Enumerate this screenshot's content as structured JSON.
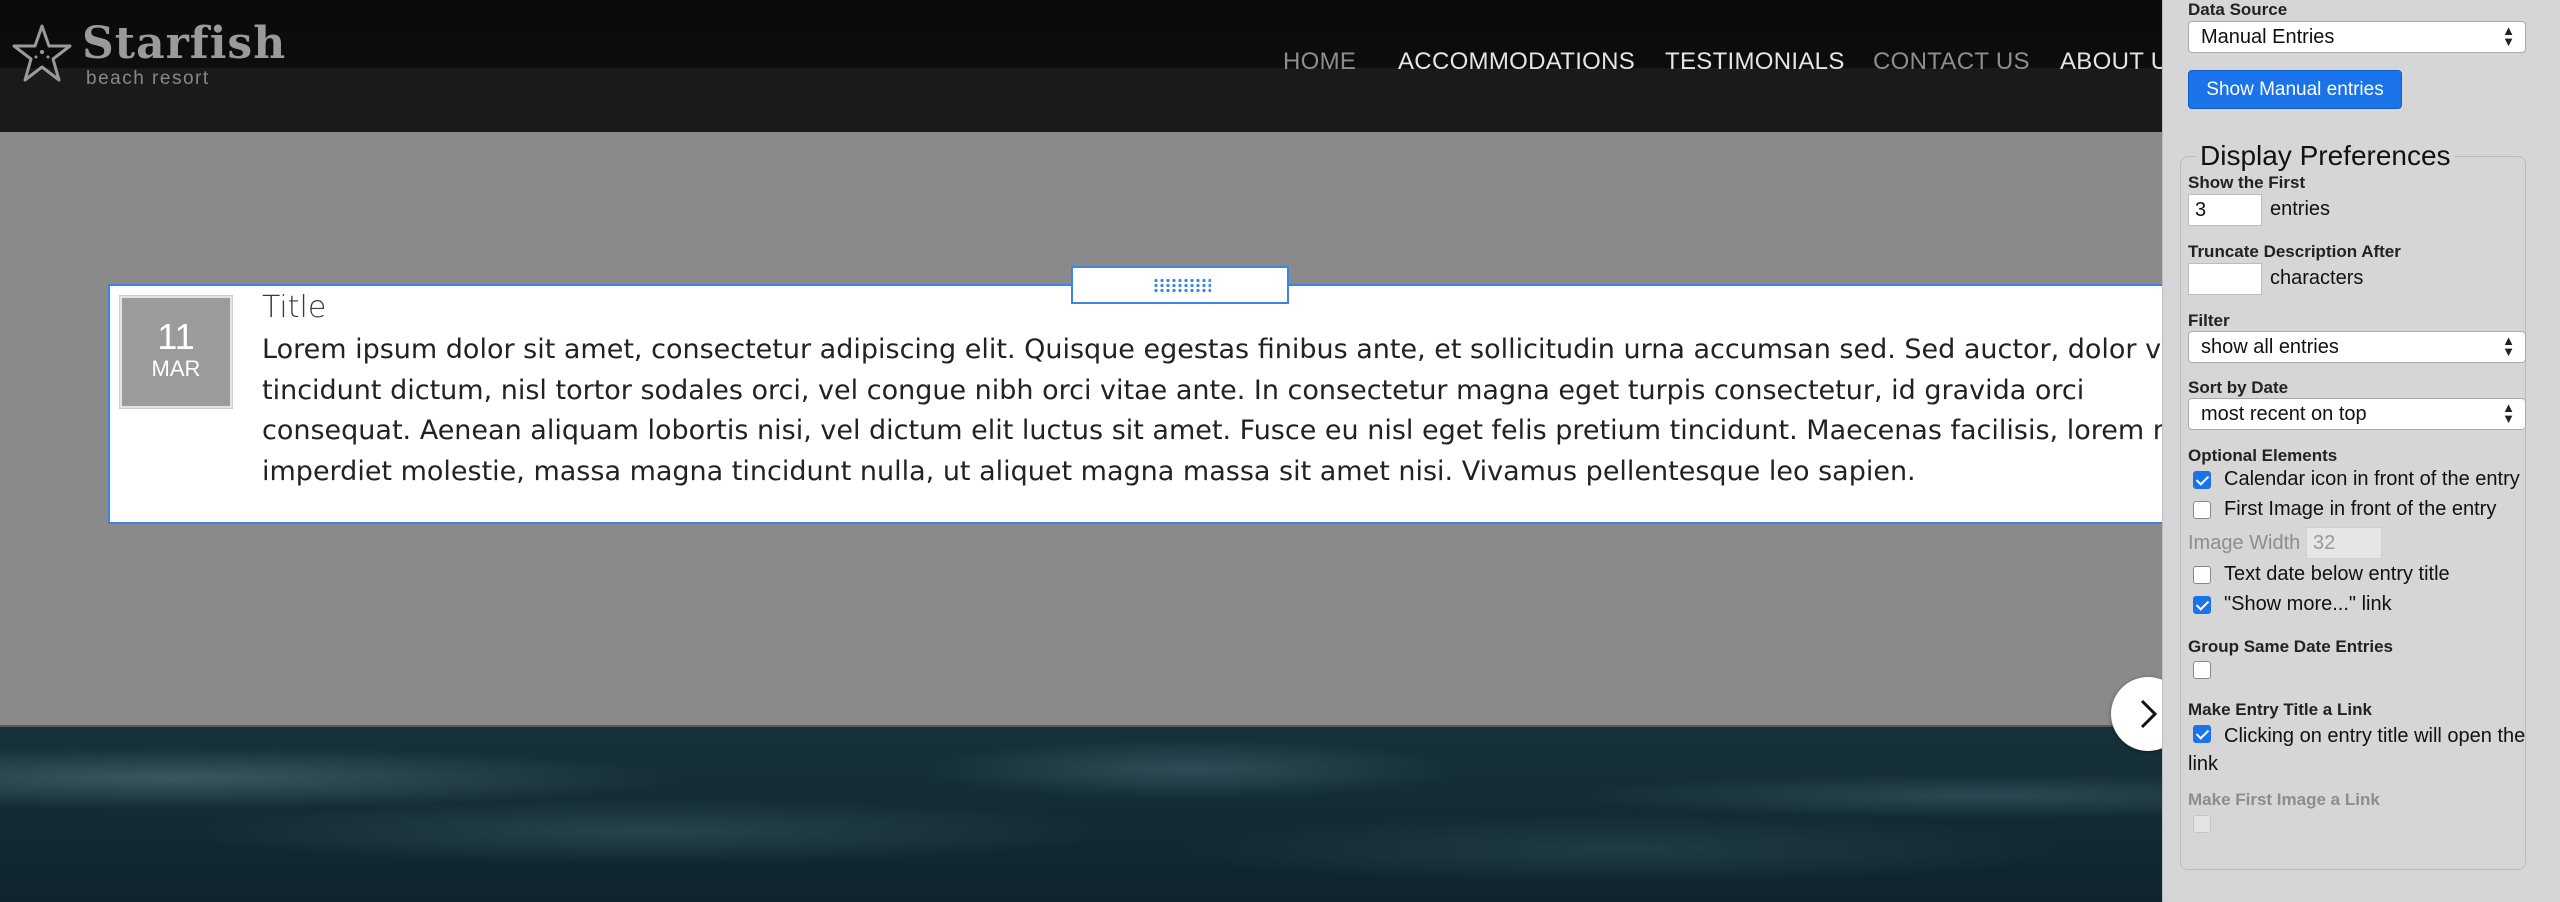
{
  "site": {
    "logo_title": "Starfish",
    "logo_subtitle": "beach resort",
    "nav": [
      "HOME",
      "ACCOMMODATIONS",
      "TESTIMONIALS",
      "CONTACT US",
      "ABOUT U"
    ]
  },
  "entry": {
    "day": "11",
    "month": "MAR",
    "title": "Title",
    "body": "Lorem ipsum dolor sit amet, consectetur adipiscing elit. Quisque egestas finibus ante, et sollicitudin urna accumsan sed. Sed auctor, dolor vitae tincidunt dictum, nisl tortor sodales orci, vel congue nibh orci vitae ante. In consectetur magna eget turpis consectetur, id gravida orci consequat. Aenean aliquam lobortis nisi, vel dictum elit luctus sit amet. Fusce eu nisl eget felis pretium tincidunt. Maecenas facilisis, lorem nec imperdiet molestie, massa magna tincidunt nulla, ut aliquet magna massa sit amet nisi. Vivamus pellentesque leo sapien."
  },
  "panel": {
    "data_source_label": "Data Source",
    "data_source_value": "Manual Entries",
    "show_manual_button": "Show Manual entries",
    "legend": "Display Preferences",
    "show_first_label": "Show the First",
    "show_first_value": "3",
    "show_first_unit": "entries",
    "truncate_label": "Truncate Description After",
    "truncate_value": "",
    "truncate_unit": "characters",
    "filter_label": "Filter",
    "filter_value": "show all entries",
    "sort_label": "Sort by Date",
    "sort_value": "most recent on top",
    "optional_label": "Optional Elements",
    "opt_calendar": "Calendar icon in front of the entry",
    "opt_first_image": "First Image in front of the entry",
    "image_width_label": "Image Width",
    "image_width_value": "32",
    "opt_text_date": "Text date below entry title",
    "opt_show_more": "\"Show more...\" link",
    "group_label": "Group Same Date Entries",
    "title_link_label": "Make Entry Title a Link",
    "title_link_text": "Clicking on entry title will open the link",
    "first_image_link_label": "Make First Image a Link"
  }
}
